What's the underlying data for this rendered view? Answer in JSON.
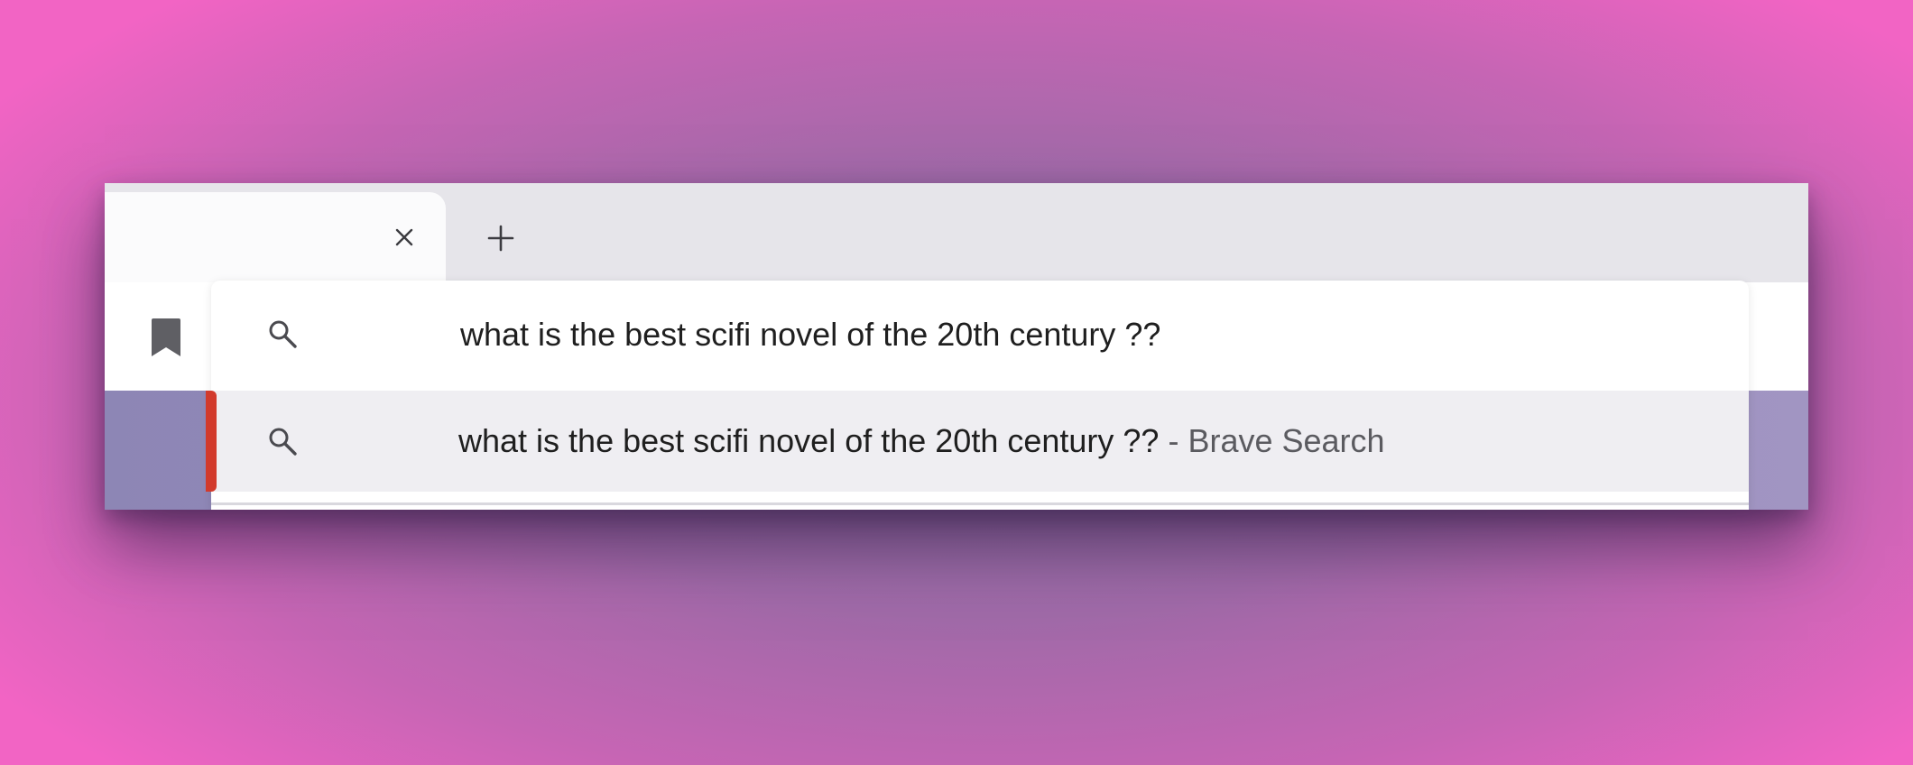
{
  "window": {
    "tab": {
      "title": "",
      "close_icon": "close-icon"
    },
    "new_tab": {
      "icon": "plus-icon"
    },
    "toolbar": {
      "bookmark_icon": "bookmark-icon"
    }
  },
  "omnibox": {
    "input_value": "what is the best scifi novel of the 20th century ??",
    "input_icon": "search-icon",
    "suggestions": [
      {
        "query": "what is the best scifi novel of the 20th century ??",
        "suffix": " - Brave Search",
        "icon": "search-icon",
        "selected": true
      }
    ]
  },
  "colors": {
    "accent": "#d23a2c",
    "tabstrip": "#e6e5ea",
    "selected_row": "#efeef2",
    "page_background": "#8d86b5"
  }
}
